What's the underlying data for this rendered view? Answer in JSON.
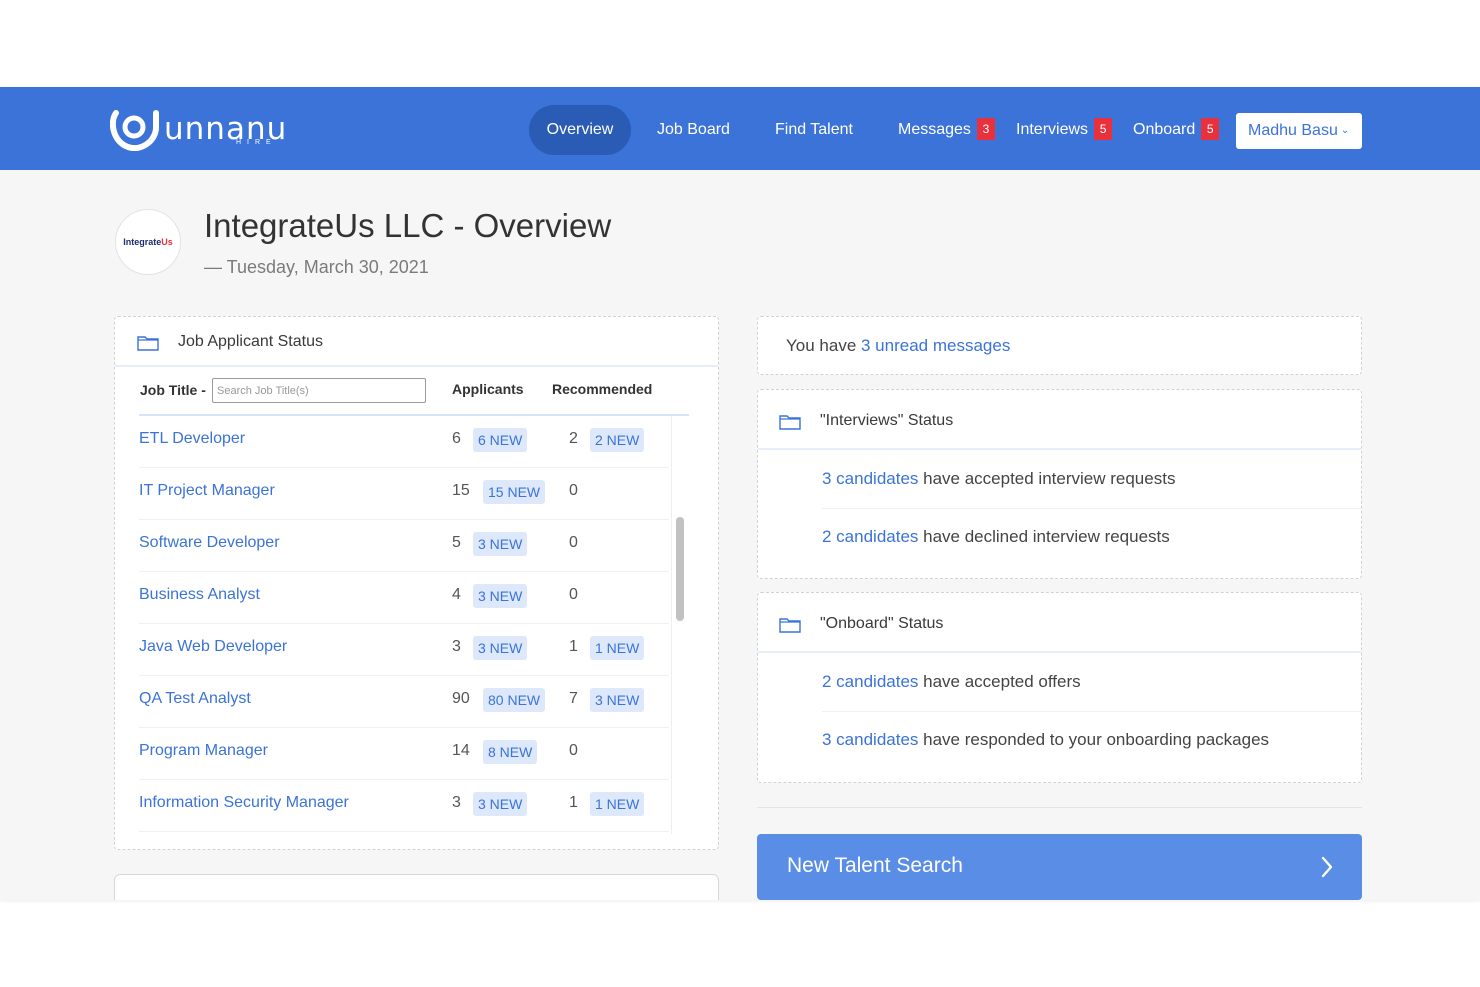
{
  "brand": {
    "name": "unnanu",
    "sub": "HIRE"
  },
  "nav": {
    "items": [
      {
        "label": "Overview"
      },
      {
        "label": "Job Board"
      },
      {
        "label": "Find Talent"
      },
      {
        "label": "Messages",
        "badge": "3"
      },
      {
        "label": "Interviews",
        "badge": "5"
      },
      {
        "label": "Onboard",
        "badge": "5"
      }
    ],
    "user": "Madhu Basu"
  },
  "company": {
    "logo_text_a": "Integrate",
    "logo_text_b": "Us",
    "title": "IntegrateUs LLC - Overview",
    "date": "— Tuesday, March 30, 2021"
  },
  "job_status": {
    "title": "Job Applicant Status",
    "col_job_title": "Job Title -",
    "search_placeholder": "Search Job Title(s)",
    "col_applicants": "Applicants",
    "col_recommended": "Recommended",
    "rows": [
      {
        "title": "ETL Developer",
        "applicants": "6",
        "applicants_new": "6 NEW",
        "recommended": "2",
        "recommended_new": "2 NEW"
      },
      {
        "title": "IT Project Manager",
        "applicants": "15",
        "applicants_new": "15 NEW",
        "recommended": "0",
        "recommended_new": null
      },
      {
        "title": "Software Developer",
        "applicants": "5",
        "applicants_new": "3 NEW",
        "recommended": "0",
        "recommended_new": null
      },
      {
        "title": "Business Analyst",
        "applicants": "4",
        "applicants_new": "3 NEW",
        "recommended": "0",
        "recommended_new": null
      },
      {
        "title": "Java Web Developer",
        "applicants": "3",
        "applicants_new": "3 NEW",
        "recommended": "1",
        "recommended_new": "1 NEW"
      },
      {
        "title": "QA Test Analyst",
        "applicants": "90",
        "applicants_new": "80 NEW",
        "recommended": "7",
        "recommended_new": "3 NEW"
      },
      {
        "title": "Program Manager",
        "applicants": "14",
        "applicants_new": "8 NEW",
        "recommended": "0",
        "recommended_new": null
      },
      {
        "title": "Information Security Manager",
        "applicants": "3",
        "applicants_new": "3 NEW",
        "recommended": "1",
        "recommended_new": "1 NEW"
      }
    ]
  },
  "messages": {
    "prefix": "You have ",
    "link": "3 unread messages"
  },
  "interviews": {
    "title": "\"Interviews\" Status",
    "lines": [
      {
        "link": "3 candidates",
        "text": " have accepted interview requests"
      },
      {
        "link": "2 candidates",
        "text": " have declined interview requests"
      }
    ]
  },
  "onboard": {
    "title": "\"Onboard\" Status",
    "lines": [
      {
        "link": "2 candidates",
        "text": " have accepted offers"
      },
      {
        "link": "3 candidates",
        "text": " have responded to your onboarding packages"
      }
    ]
  },
  "talent_search": {
    "label": "New Talent Search"
  },
  "colors": {
    "header": "#3b73d8",
    "header_active": "#2a5cb6",
    "badge": "#e8313c",
    "link": "#3b73d8",
    "tag_bg": "#dde9fb",
    "cta": "#5a8de6"
  }
}
